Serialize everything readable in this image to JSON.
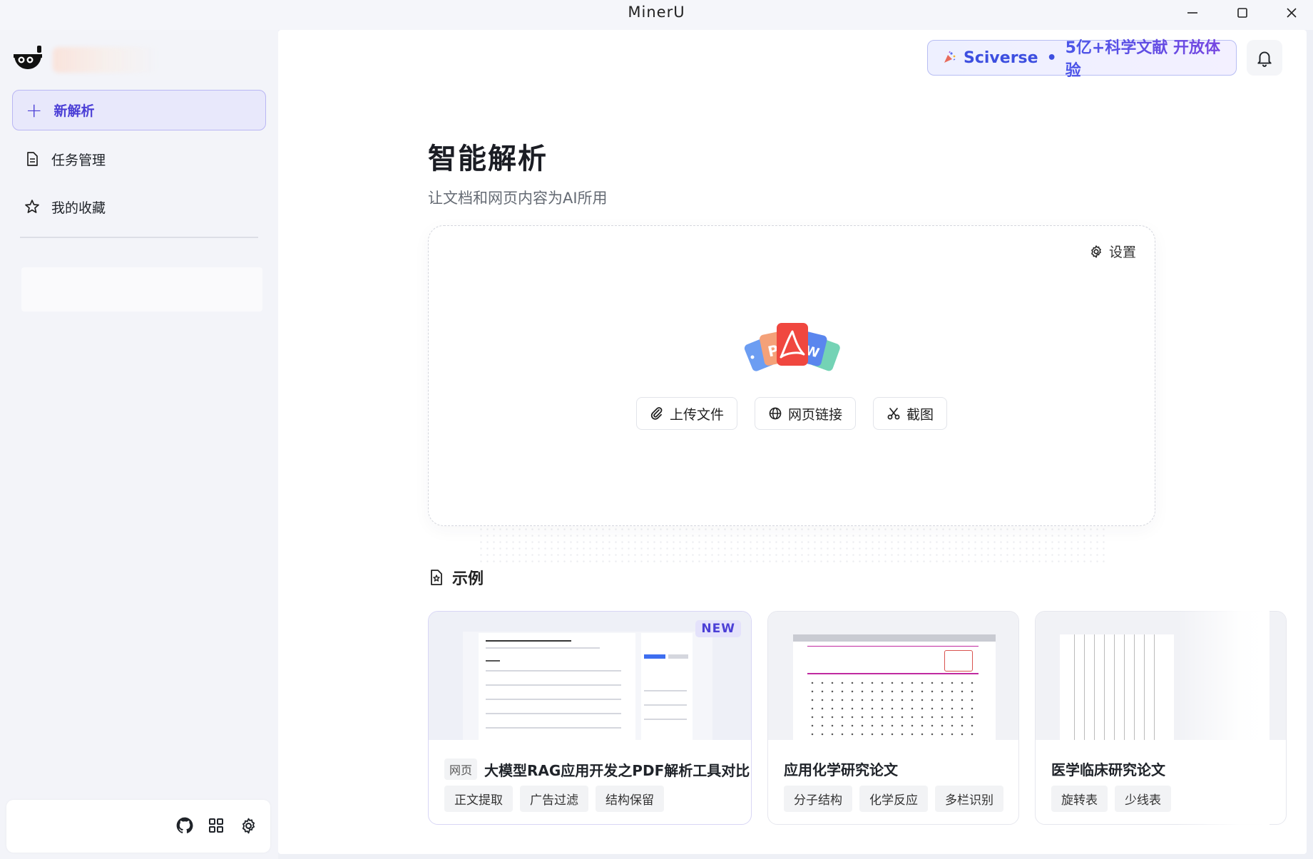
{
  "window": {
    "title": "MinerU"
  },
  "sidebar": {
    "new_parse_label": "新解析",
    "nav_items": [
      {
        "label": "任务管理",
        "icon": "document-icon"
      },
      {
        "label": "我的收藏",
        "icon": "star-icon"
      }
    ],
    "footer_icons": [
      "github-icon",
      "apps-grid-icon",
      "gear-icon"
    ]
  },
  "header": {
    "promo": {
      "brand": "Sciverse",
      "separator": "•",
      "text": "5亿+科学文献 开放体验"
    }
  },
  "main": {
    "title": "智能解析",
    "subtitle": "让文档和网页内容为AI所用",
    "upload": {
      "settings_label": "设置",
      "actions": [
        {
          "label": "上传文件",
          "icon": "paperclip-icon"
        },
        {
          "label": "网页链接",
          "icon": "globe-icon"
        },
        {
          "label": "截图",
          "icon": "scissors-icon"
        }
      ]
    },
    "examples": {
      "heading": "示例",
      "cards": [
        {
          "badge": "NEW",
          "source_tag": "网页",
          "title": "大模型RAG应用开发之PDF解析工具对比",
          "tags": [
            "正文提取",
            "广告过滤",
            "结构保留"
          ]
        },
        {
          "title": "应用化学研究论文",
          "tags": [
            "分子结构",
            "化学反应",
            "多栏识别"
          ]
        },
        {
          "title": "医学临床研究论文",
          "tags": [
            "旋转表",
            "少线表"
          ]
        }
      ]
    }
  },
  "colors": {
    "accent": "#4b3fd6",
    "promo_blue": "#3d4fe0",
    "sidebar_bg": "#f3f4f9"
  }
}
